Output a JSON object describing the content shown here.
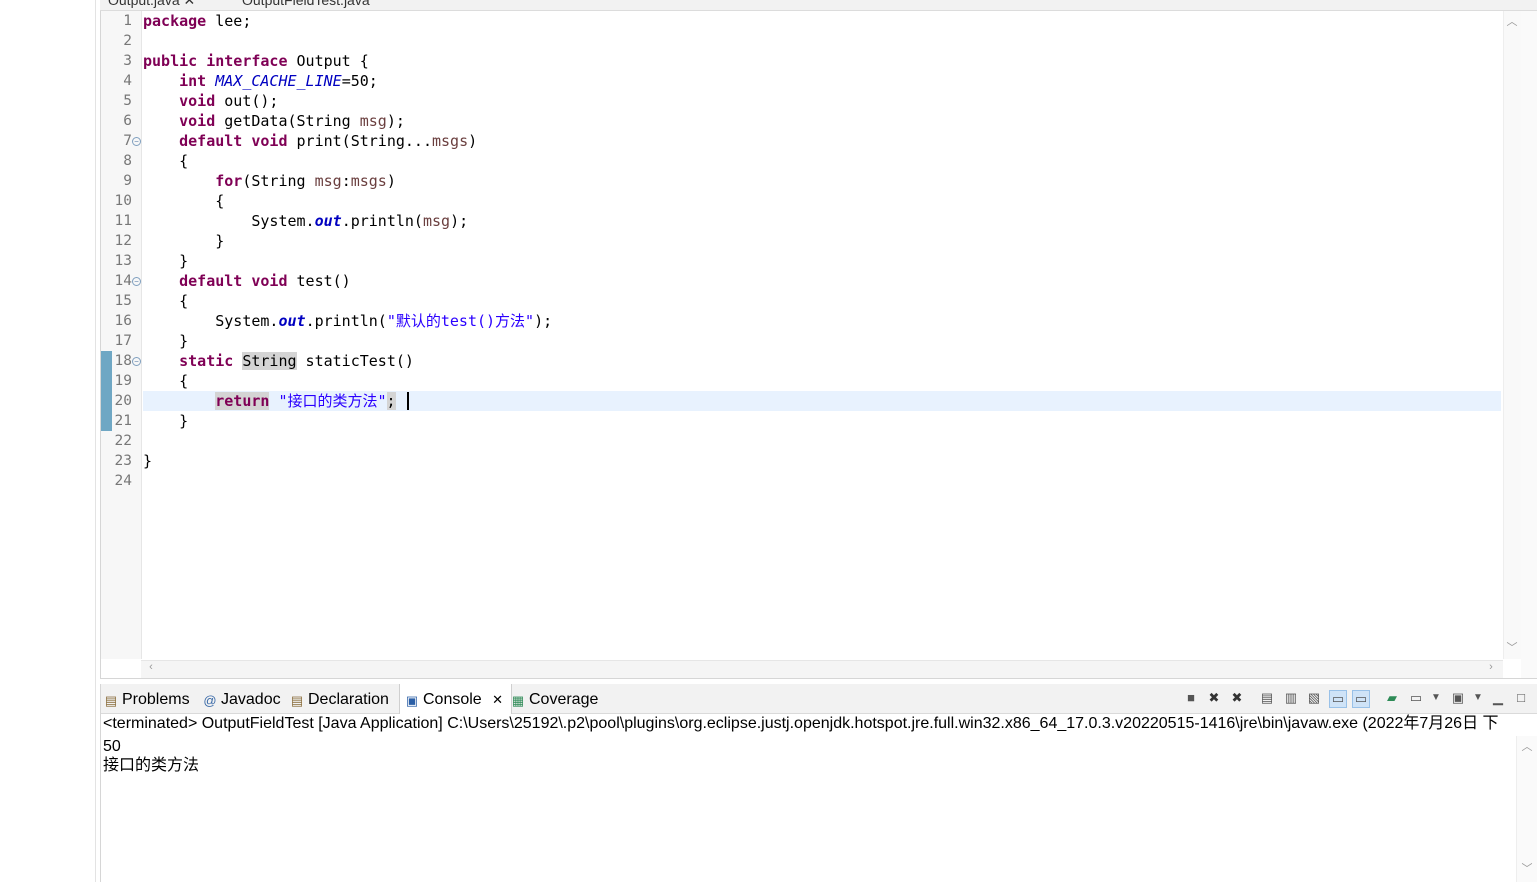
{
  "editor": {
    "tabs": [
      "Output.java",
      "OutputFieldTest.java"
    ],
    "lines": [
      {
        "n": "1",
        "tokens": [
          {
            "t": "package",
            "c": "kw"
          },
          {
            "t": " lee;",
            "c": ""
          }
        ]
      },
      {
        "n": "2",
        "tokens": []
      },
      {
        "n": "3",
        "tokens": [
          {
            "t": "public",
            "c": "kw"
          },
          {
            "t": " ",
            "c": ""
          },
          {
            "t": "interface",
            "c": "kw"
          },
          {
            "t": " Output {",
            "c": ""
          }
        ]
      },
      {
        "n": "4",
        "tokens": [
          {
            "t": "    ",
            "c": ""
          },
          {
            "t": "int",
            "c": "kw"
          },
          {
            "t": " ",
            "c": ""
          },
          {
            "t": "MAX_CACHE_LINE",
            "c": "cst"
          },
          {
            "t": "=50;",
            "c": ""
          }
        ]
      },
      {
        "n": "5",
        "tokens": [
          {
            "t": "    ",
            "c": ""
          },
          {
            "t": "void",
            "c": "kw"
          },
          {
            "t": " out();",
            "c": ""
          }
        ]
      },
      {
        "n": "6",
        "tokens": [
          {
            "t": "    ",
            "c": ""
          },
          {
            "t": "void",
            "c": "kw"
          },
          {
            "t": " getData(String ",
            "c": ""
          },
          {
            "t": "msg",
            "c": "var"
          },
          {
            "t": ");",
            "c": ""
          }
        ]
      },
      {
        "n": "7",
        "fold": true,
        "tokens": [
          {
            "t": "    ",
            "c": ""
          },
          {
            "t": "default",
            "c": "kw"
          },
          {
            "t": " ",
            "c": ""
          },
          {
            "t": "void",
            "c": "kw"
          },
          {
            "t": " print(String...",
            "c": ""
          },
          {
            "t": "msgs",
            "c": "var"
          },
          {
            "t": ")",
            "c": ""
          }
        ]
      },
      {
        "n": "8",
        "tokens": [
          {
            "t": "    {",
            "c": ""
          }
        ]
      },
      {
        "n": "9",
        "tokens": [
          {
            "t": "        ",
            "c": ""
          },
          {
            "t": "for",
            "c": "kw"
          },
          {
            "t": "(String ",
            "c": ""
          },
          {
            "t": "msg",
            "c": "var"
          },
          {
            "t": ":",
            "c": ""
          },
          {
            "t": "msgs",
            "c": "var"
          },
          {
            "t": ")",
            "c": ""
          }
        ]
      },
      {
        "n": "10",
        "tokens": [
          {
            "t": "        {",
            "c": ""
          }
        ]
      },
      {
        "n": "11",
        "tokens": [
          {
            "t": "            System.",
            "c": ""
          },
          {
            "t": "out",
            "c": "fld"
          },
          {
            "t": ".println(",
            "c": ""
          },
          {
            "t": "msg",
            "c": "var"
          },
          {
            "t": ");",
            "c": ""
          }
        ]
      },
      {
        "n": "12",
        "tokens": [
          {
            "t": "        }",
            "c": ""
          }
        ]
      },
      {
        "n": "13",
        "tokens": [
          {
            "t": "    }",
            "c": ""
          }
        ]
      },
      {
        "n": "14",
        "fold": true,
        "tokens": [
          {
            "t": "    ",
            "c": ""
          },
          {
            "t": "default",
            "c": "kw"
          },
          {
            "t": " ",
            "c": ""
          },
          {
            "t": "void",
            "c": "kw"
          },
          {
            "t": " test()",
            "c": ""
          }
        ]
      },
      {
        "n": "15",
        "tokens": [
          {
            "t": "    {",
            "c": ""
          }
        ]
      },
      {
        "n": "16",
        "tokens": [
          {
            "t": "        System.",
            "c": ""
          },
          {
            "t": "out",
            "c": "fld"
          },
          {
            "t": ".println(",
            "c": ""
          },
          {
            "t": "\"默认的test()方法\"",
            "c": "str"
          },
          {
            "t": ");",
            "c": ""
          }
        ]
      },
      {
        "n": "17",
        "tokens": [
          {
            "t": "    }",
            "c": ""
          }
        ]
      },
      {
        "n": "18",
        "fold": true,
        "tokens": [
          {
            "t": "    ",
            "c": ""
          },
          {
            "t": "static",
            "c": "kw"
          },
          {
            "t": " ",
            "c": ""
          },
          {
            "t": "String",
            "c": "hl-word"
          },
          {
            "t": " staticTest()",
            "c": ""
          }
        ]
      },
      {
        "n": "19",
        "tokens": [
          {
            "t": "    {",
            "c": ""
          }
        ]
      },
      {
        "n": "20",
        "tokens": [
          {
            "t": "        ",
            "c": ""
          },
          {
            "t": "return",
            "c": "kw hl-word"
          },
          {
            "t": " ",
            "c": ""
          },
          {
            "t": "\"接口的类方法\"",
            "c": "str"
          },
          {
            "t": ";",
            "c": "hl-word"
          }
        ]
      },
      {
        "n": "21",
        "tokens": [
          {
            "t": "    }",
            "c": ""
          }
        ]
      },
      {
        "n": "22",
        "tokens": []
      },
      {
        "n": "23",
        "tokens": [
          {
            "t": "}",
            "c": ""
          }
        ]
      },
      {
        "n": "24",
        "tokens": []
      }
    ]
  },
  "views": {
    "tabs": [
      {
        "label": "Problems",
        "icon": "problems-icon",
        "glyph": "🗎"
      },
      {
        "label": "Javadoc",
        "icon": "javadoc-icon",
        "glyph": "@"
      },
      {
        "label": "Declaration",
        "icon": "declaration-icon",
        "glyph": "🗎"
      },
      {
        "label": "Console",
        "icon": "console-icon",
        "glyph": "▭"
      },
      {
        "label": "Coverage",
        "icon": "coverage-icon",
        "glyph": "▦"
      }
    ]
  },
  "console": {
    "header": "<terminated> OutputFieldTest [Java Application] C:\\Users\\25192\\.p2\\pool\\plugins\\org.eclipse.justj.openjdk.hotspot.jre.full.win32.x86_64_17.0.3.v20220515-1416\\jre\\bin\\javaw.exe  (2022年7月26日 下",
    "output": [
      "50",
      "接口的类方法"
    ]
  },
  "colors": {
    "keyword": "#7f0055",
    "string": "#2a00ff",
    "field": "#0000c0",
    "local_var": "#6a3e3e",
    "current_line": "#e8f2fe",
    "change_bar": "#6fa7c4"
  }
}
